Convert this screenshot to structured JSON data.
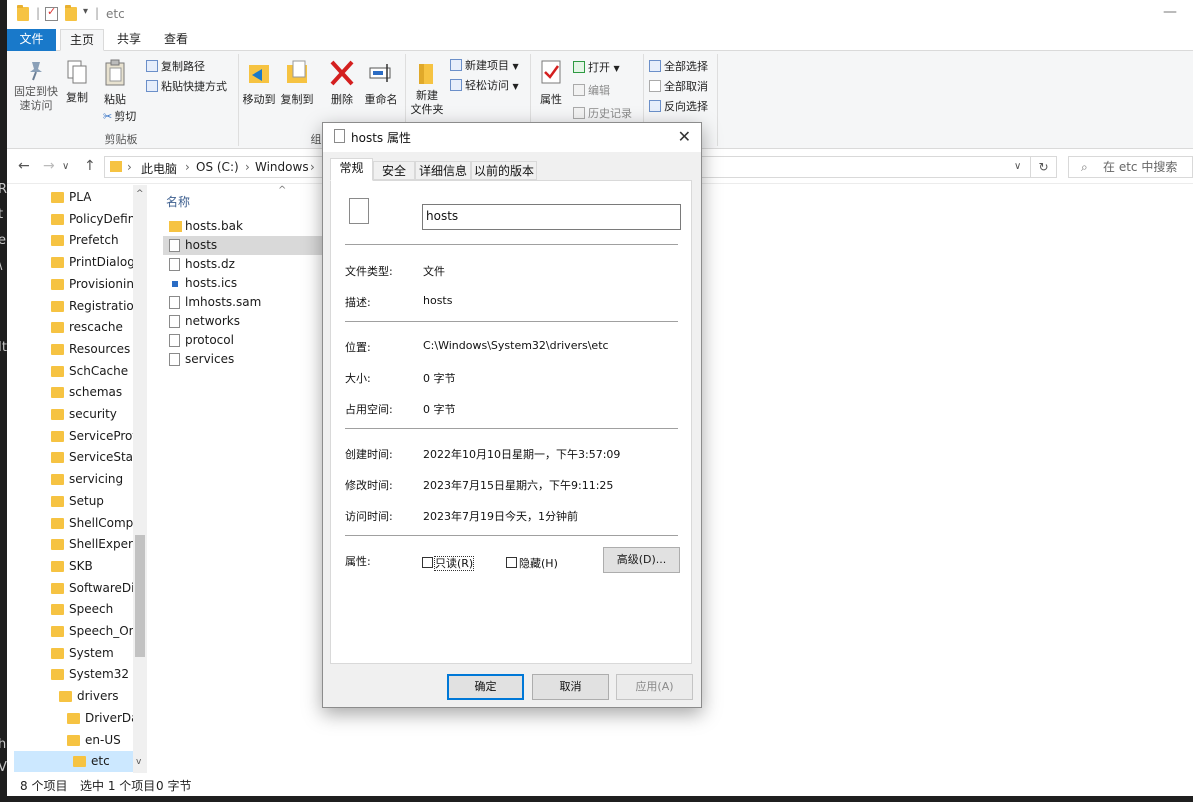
{
  "window": {
    "title": "etc"
  },
  "background": {
    "fragments": [
      "R",
      "t",
      "e",
      "\\",
      "It",
      "h",
      "V"
    ]
  },
  "ribbon_tabs": [
    {
      "label": "文件"
    },
    {
      "label": "主页"
    },
    {
      "label": "共享"
    },
    {
      "label": "查看"
    }
  ],
  "ribbon": {
    "pin": "固定到快\n速访问",
    "copy": "复制",
    "paste": "粘贴",
    "copy_path": "复制路径",
    "paste_shortcut": "粘贴快捷方式",
    "cut": "剪切",
    "clipboard_group": "剪贴板",
    "move_to": "移动到",
    "copy_to": "复制到",
    "organize_group": "组",
    "delete": "删除",
    "rename": "重命名",
    "new_folder": "新建\n文件夹",
    "new_item": "新建项目",
    "easy_access": "轻松访问",
    "properties": "属性",
    "open": "打开",
    "edit": "编辑",
    "history": "历史记录",
    "select_all": "全部选择",
    "select_none": "全部取消",
    "invert_selection": "反向选择"
  },
  "address": {
    "crumbs": [
      "此电脑",
      "OS (C:)",
      "Windows"
    ],
    "search_placeholder": "在 etc 中搜索"
  },
  "nav_tree": {
    "items": [
      "PLA",
      "PolicyDefinit",
      "Prefetch",
      "PrintDialog",
      "Provisioning",
      "Registration",
      "rescache",
      "Resources",
      "SchCache",
      "schemas",
      "security",
      "ServiceProfil",
      "ServiceState",
      "servicing",
      "Setup",
      "ShellCompo",
      "ShellExperie",
      "SKB",
      "SoftwareDis",
      "Speech",
      "Speech_One",
      "System",
      "System32"
    ],
    "sub_items": [
      "drivers",
      "DriverDat",
      "en-US",
      "etc"
    ]
  },
  "filelist": {
    "column_name": "名称",
    "files": [
      {
        "name": "hosts.bak",
        "kind": "folder"
      },
      {
        "name": "hosts",
        "kind": "file"
      },
      {
        "name": "hosts.dz",
        "kind": "file"
      },
      {
        "name": "hosts.ics",
        "kind": "cal"
      },
      {
        "name": "lmhosts.sam",
        "kind": "file"
      },
      {
        "name": "networks",
        "kind": "file"
      },
      {
        "name": "protocol",
        "kind": "file"
      },
      {
        "name": "services",
        "kind": "file"
      }
    ]
  },
  "status": {
    "count": "8 个项目",
    "selected": "选中 1 个项目",
    "size": "0 字节"
  },
  "dialog": {
    "title": "hosts 属性",
    "tabs": [
      "常规",
      "安全",
      "详细信息",
      "以前的版本"
    ],
    "filename": "hosts",
    "type_label": "文件类型:",
    "type_value": "文件",
    "desc_label": "描述:",
    "desc_value": "hosts",
    "location_label": "位置:",
    "location_value": "C:\\Windows\\System32\\drivers\\etc",
    "size_label": "大小:",
    "size_value": "0 字节",
    "disk_label": "占用空间:",
    "disk_value": "0 字节",
    "created_label": "创建时间:",
    "created_value": "2022年10月10日星期一，下午3:57:09",
    "modified_label": "修改时间:",
    "modified_value": "2023年7月15日星期六，下午9:11:25",
    "accessed_label": "访问时间:",
    "accessed_value": "2023年7月19日今天，1分钟前",
    "attr_label": "属性:",
    "readonly_label": "只读(R)",
    "hidden_label": "隐藏(H)",
    "advanced_label": "高级(D)...",
    "ok_label": "确定",
    "cancel_label": "取消",
    "apply_label": "应用(A)"
  }
}
